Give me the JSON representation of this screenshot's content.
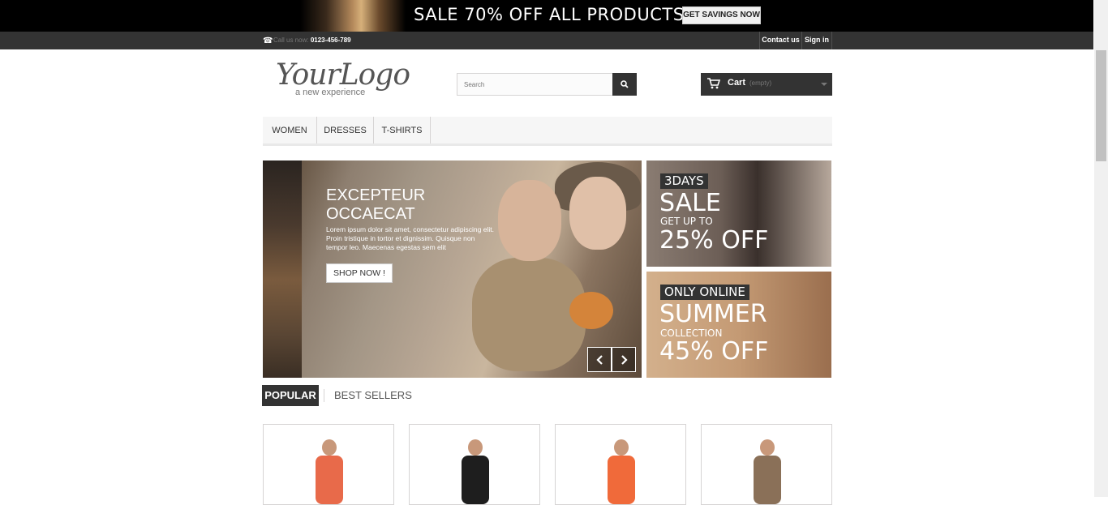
{
  "promo_banner": {
    "text": "SALE 70% OFF ALL PRODUCTS",
    "button_label": "GET SAVINGS NOW"
  },
  "nav": {
    "phone_prefix": "Call us now:",
    "phone_number": "0123-456-789",
    "contact_label": "Contact us",
    "signin_label": "Sign in"
  },
  "header": {
    "logo_main": "YourLogo",
    "logo_tagline": "a new experience",
    "search_placeholder": "Search",
    "cart_label": "Cart",
    "cart_status": "(empty)"
  },
  "menu": {
    "items": [
      "WOMEN",
      "DRESSES",
      "T-SHIRTS"
    ]
  },
  "slider": {
    "title_line1": "EXCEPTEUR",
    "title_line2": "OCCAECAT",
    "text": "Lorem ipsum dolor sit amet, consectetur adipiscing elit. Proin tristique in tortor et dignissim. Quisque non tempor leo. Maecenas egestas sem elit",
    "button_label": "SHOP NOW !"
  },
  "side_promos": [
    {
      "tag": "3DAYS",
      "big1": "SALE",
      "small": "GET UP TO",
      "big2": "25% OFF"
    },
    {
      "tag": "ONLY ONLINE",
      "big1": "SUMMER",
      "small": "COLLECTION",
      "big2": "45% OFF"
    }
  ],
  "tabs": {
    "popular": "POPULAR",
    "best_sellers": "BEST SELLERS"
  },
  "products": [
    {
      "color": "#e86a4a"
    },
    {
      "color": "#1e1e1e"
    },
    {
      "color": "#f06a3a"
    },
    {
      "color": "#8a7058"
    }
  ]
}
